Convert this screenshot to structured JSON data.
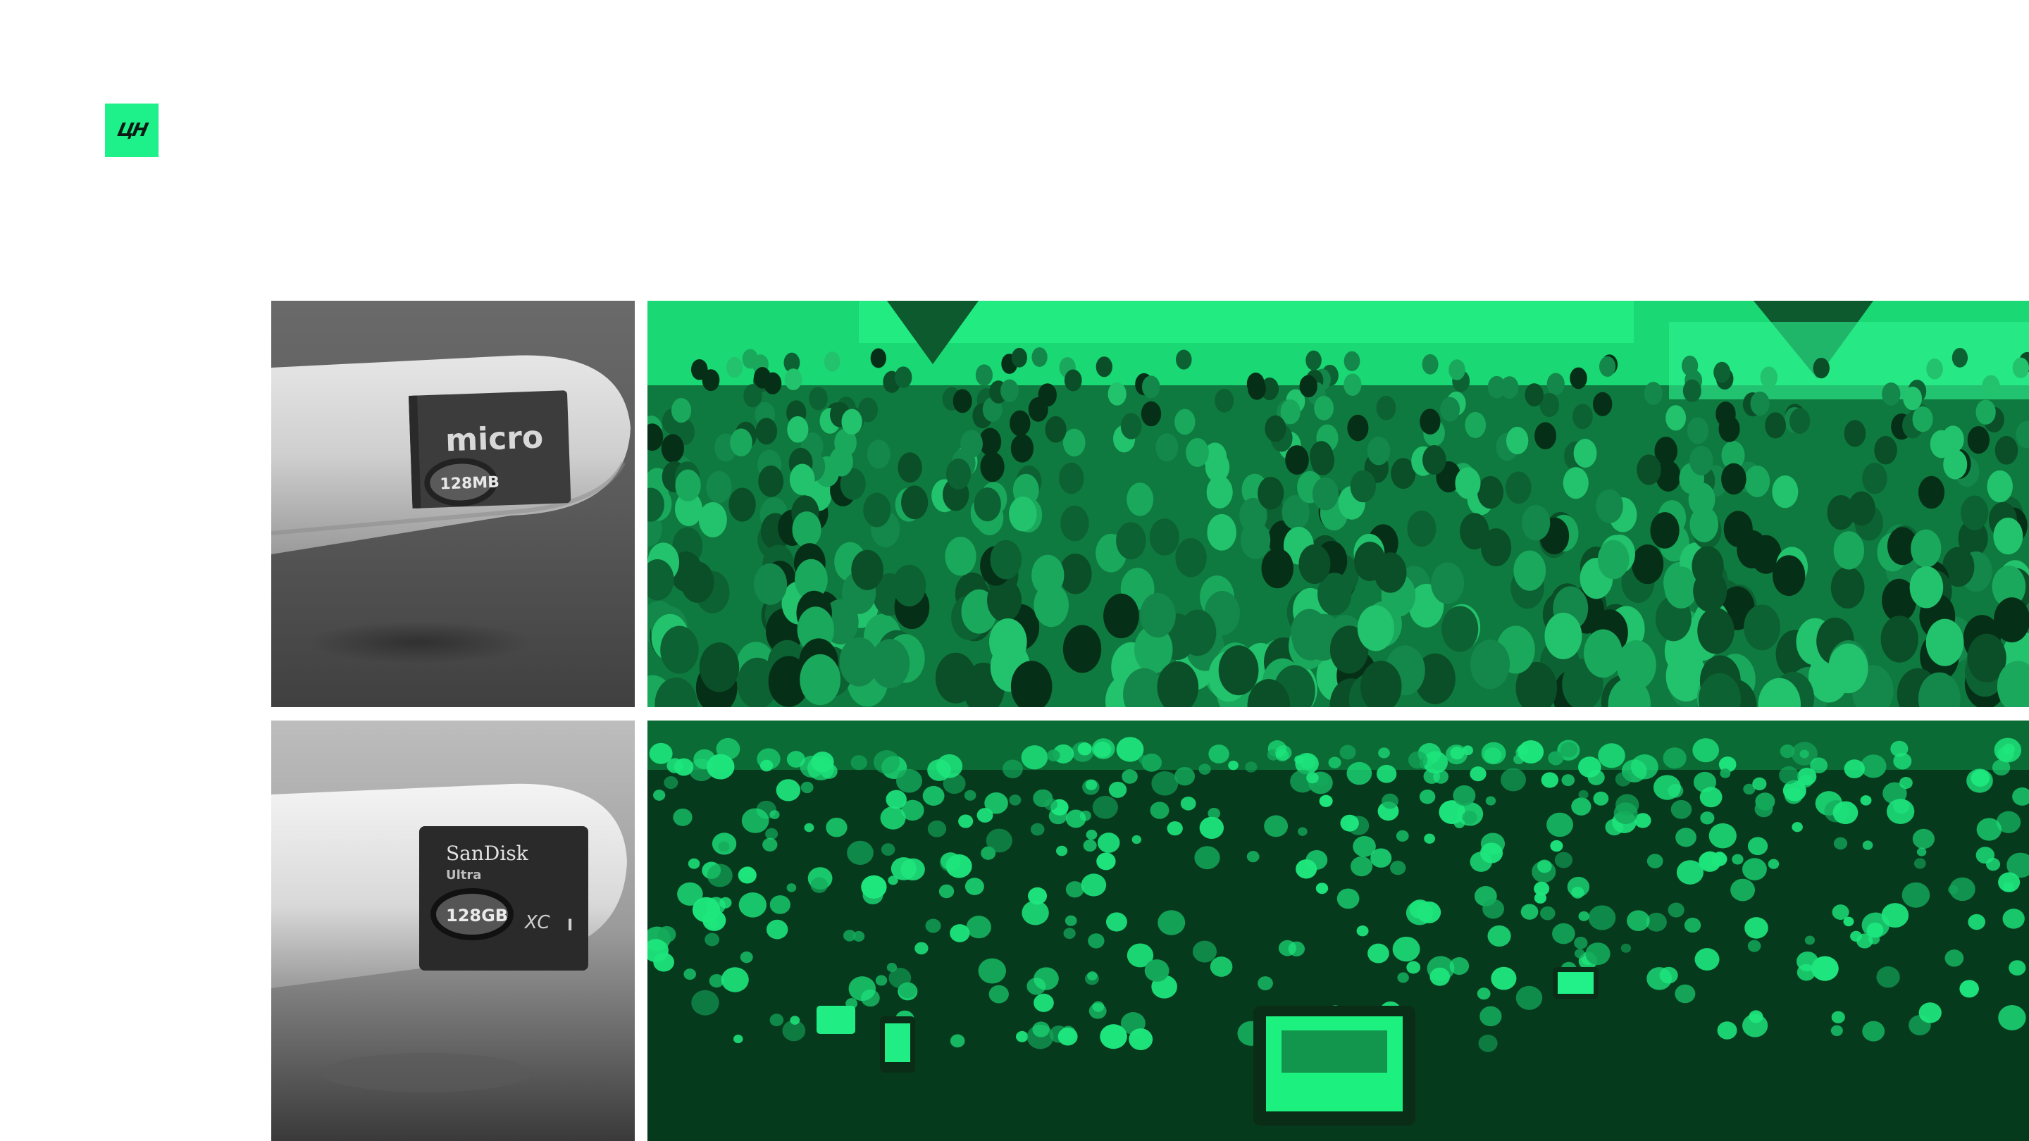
{
  "brand": {
    "logo_text": "ЦН",
    "accent_color": "#1ef08a"
  },
  "photos": {
    "card_small": {
      "brand_text": "micro",
      "capacity_text": "128MB"
    },
    "card_large": {
      "brand_text": "SanDisk",
      "sub_text": "Ultra",
      "capacity_text": "128GB",
      "format_text": "XC",
      "class_text": "I"
    }
  },
  "colors": {
    "green_tint": "#18d86f",
    "dark_green": "#063a1d"
  }
}
